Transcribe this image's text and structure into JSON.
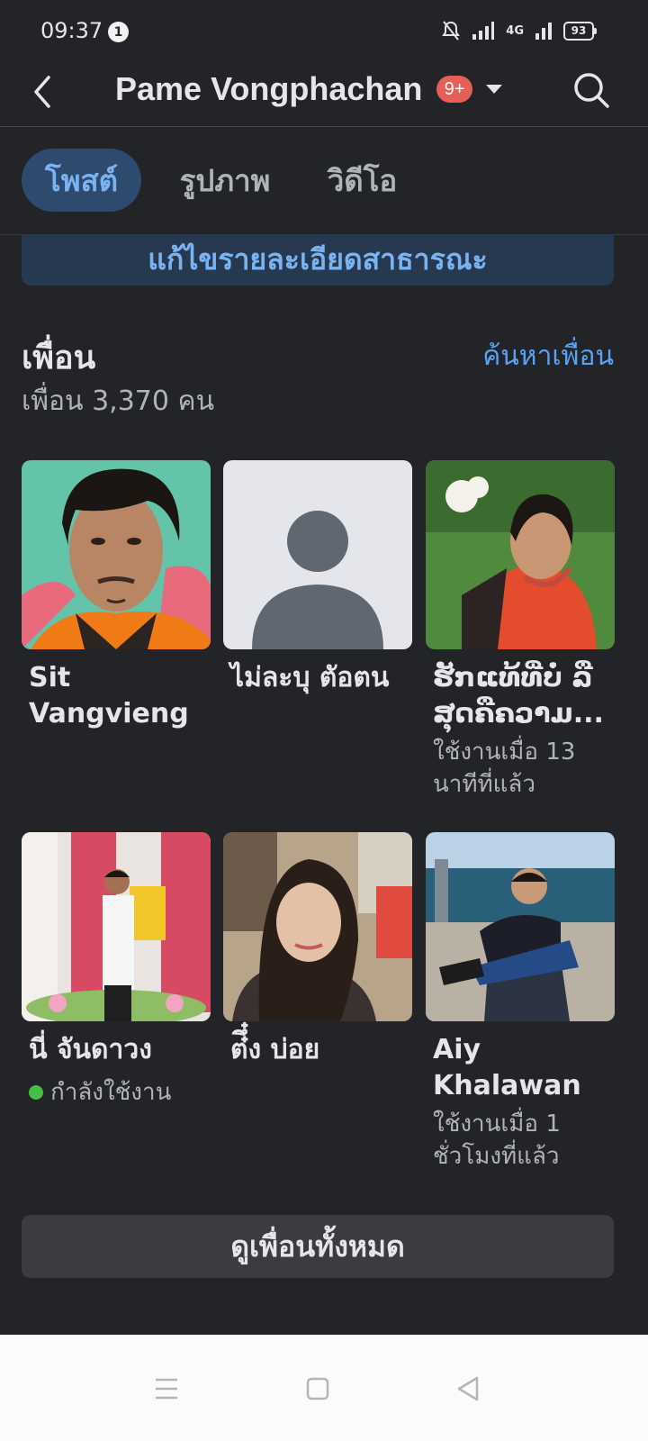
{
  "status": {
    "time": "09:37",
    "notification_count": "1",
    "network": "4G",
    "battery": "93"
  },
  "header": {
    "title": "Pame Vongphachan",
    "badge": "9+"
  },
  "tabs": [
    {
      "label": "โพสต์",
      "active": true
    },
    {
      "label": "รูปภาพ",
      "active": false
    },
    {
      "label": "วิดีโอ",
      "active": false
    }
  ],
  "edit_details_label": "แก้ไขรายละเอียดสาธารณะ",
  "friends": {
    "title": "เพื่อน",
    "find_label": "ค้นหาเพื่อน",
    "count_text": "เพื่อน 3,370 คน",
    "items": [
      {
        "name": "Sit Vangvieng",
        "status": ""
      },
      {
        "name": "ไม่ละบุ ตัอตน",
        "status": ""
      },
      {
        "name": "ຮັກແທ້ທີ່ບໍ່ ລື ສຸດຄືຄວາມ...",
        "status": "ใช้งานเมื่อ 13 นาทีที่แล้ว"
      },
      {
        "name": "นี่ จันดาวง",
        "status": "กำลังใช้งาน"
      },
      {
        "name": "ต๋ึ๋ง บ่อย",
        "status": ""
      },
      {
        "name": "Aiy Khalawan",
        "status": "ใช้งานเมื่อ 1 ชั่วโมงที่แล้ว"
      }
    ]
  },
  "see_all_label": "ดูเพื่อนทั้งหมด",
  "nav": {
    "menu_icon": "menu-icon",
    "home_icon": "square-icon",
    "back_icon": "triangle-back-icon"
  }
}
